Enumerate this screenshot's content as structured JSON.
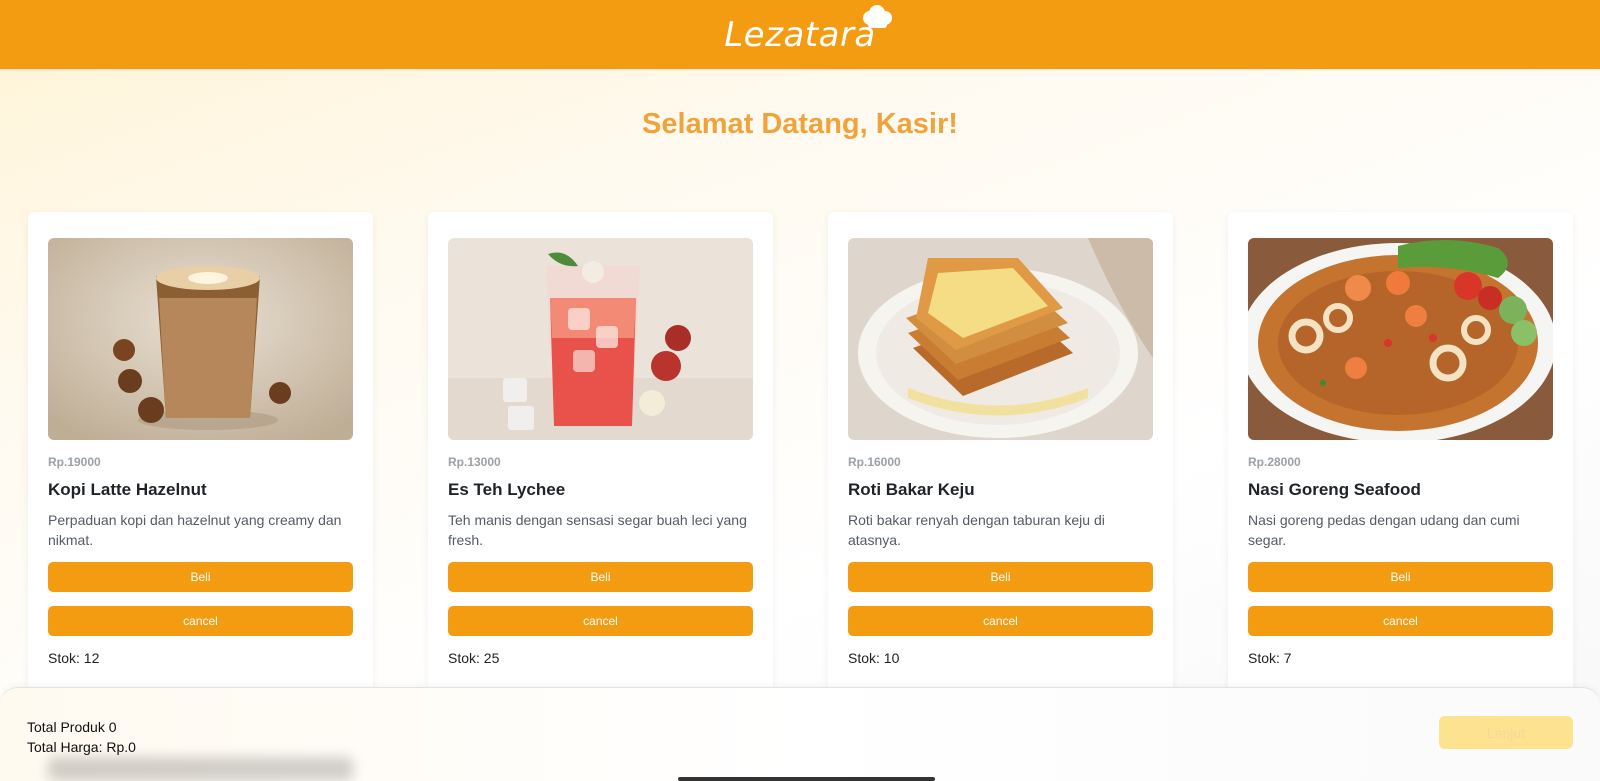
{
  "header": {
    "logo_text": "Lezatara"
  },
  "welcome": "Selamat Datang, Kasir!",
  "colors": {
    "accent": "#f39c12",
    "title": "#f0a33a",
    "disabled_button": "#fde28f"
  },
  "products": [
    {
      "price": "Rp.19000",
      "name": "Kopi Latte Hazelnut",
      "description": "Perpaduan kopi dan hazelnut yang creamy dan nikmat.",
      "buy_label": "Beli",
      "cancel_label": "cancel",
      "stock": "Stok: 12",
      "image": "latte-image"
    },
    {
      "price": "Rp.13000",
      "name": "Es Teh Lychee",
      "description": "Teh manis dengan sensasi segar buah leci yang fresh.",
      "buy_label": "Beli",
      "cancel_label": "cancel",
      "stock": "Stok: 25",
      "image": "lychee-tea-image"
    },
    {
      "price": "Rp.16000",
      "name": "Roti Bakar Keju",
      "description": "Roti bakar renyah dengan taburan keju di atasnya.",
      "buy_label": "Beli",
      "cancel_label": "cancel",
      "stock": "Stok: 10",
      "image": "cheese-toast-image"
    },
    {
      "price": "Rp.28000",
      "name": "Nasi Goreng Seafood",
      "description": "Nasi goreng pedas dengan udang dan cumi segar.",
      "buy_label": "Beli",
      "cancel_label": "cancel",
      "stock": "Stok: 7",
      "image": "seafood-fried-rice-image"
    }
  ],
  "footer": {
    "total_products": "Total Produk 0",
    "total_price": "Total Harga: Rp.0",
    "next_label": "Lanjut"
  }
}
